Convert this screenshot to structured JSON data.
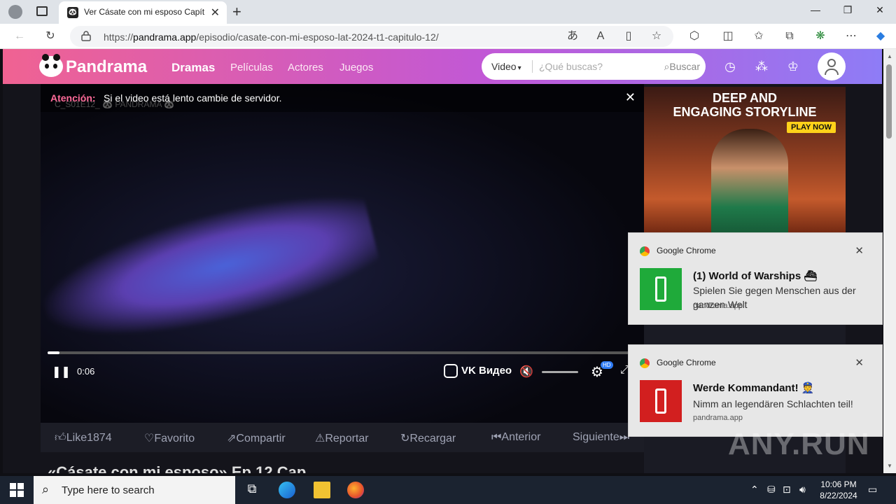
{
  "browser": {
    "tab_title": "Ver Cásate con mi esposo Capítul",
    "url_prefix": "https://",
    "url_domain": "pandrama.app",
    "url_path": "/episodio/casate-con-mi-esposo-lat-2024-t1-capitulo-12/"
  },
  "site": {
    "logo_text": "Pandrama",
    "nav": [
      "Dramas",
      "Películas",
      "Actores",
      "Juegos"
    ],
    "search_select": "Video",
    "search_placeholder": "¿Qué buscas?",
    "search_button": "Buscar"
  },
  "video": {
    "alert_label": "Atención:",
    "alert_message": "Si el video está lento cambie de servidor.",
    "watermark": "C_S01E12_ 🐼 PANDRAMA 🐼",
    "time": "0:06",
    "progress": 0.02,
    "player_brand": "VK Видео",
    "hd_badge": "HD"
  },
  "actions": [
    "Like1874",
    "Favorito",
    "Compartir",
    "Reportar",
    "Recargar",
    "Anterior",
    "Siguiente"
  ],
  "subtitle_partial": "«Cásate con mi esposo» Ep 12 Cap",
  "ad": {
    "headline_1": "DEEP AND",
    "headline_2": "ENGAGING STORYLINE",
    "cta": "PLAY NOW"
  },
  "notifications": [
    {
      "app": "Google Chrome",
      "title": "(1) World of Warships ⛴",
      "body": "Spielen Sie gegen Menschen aus der ganzen Welt",
      "source": "pandrama.app",
      "color": "#1faa3a"
    },
    {
      "app": "Google Chrome",
      "title": "Werde Kommandant! 👮",
      "body": "Nimm an legendären Schlachten teil!",
      "source": "pandrama.app",
      "color": "#d21f1f"
    }
  ],
  "taskbar": {
    "search_placeholder": "Type here to search",
    "time": "10:06 PM",
    "date": "8/22/2024"
  },
  "watermark_brand": "ANY.RUN"
}
